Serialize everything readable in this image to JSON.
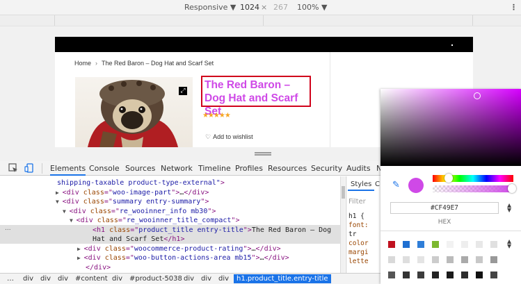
{
  "device_toolbar": {
    "mode": "Responsive ▼",
    "width": "1024",
    "times": "×",
    "height": "267",
    "zoom": "100% ▼",
    "menu_icon": "more-vertical-icon"
  },
  "page": {
    "breadcrumb": {
      "home": "Home",
      "separator": "›",
      "current": "The Red Baron – Dog Hat and Scarf Set"
    },
    "product_title": "The Red Baron – Dog Hat and Scarf Set",
    "title_color": "#cf49e7",
    "stars": "★★★★★",
    "wishlist": "Add to wishlist"
  },
  "devtools": {
    "tabs": [
      "Elements",
      "Console",
      "Sources",
      "Network",
      "Timeline",
      "Profiles",
      "Resources",
      "Security",
      "Audits",
      "N"
    ],
    "active_tab": "Elements",
    "elements": [
      {
        "indent": 82,
        "tri": "",
        "parts": [
          [
            "av",
            "shipping-taxable product-type-external\""
          ],
          [
            "tg",
            ">"
          ]
        ]
      },
      {
        "indent": 92,
        "tri": "▶",
        "parts": [
          [
            "tg",
            "<div "
          ],
          [
            "an",
            "class"
          ],
          [
            "tg",
            "=\""
          ],
          [
            "av",
            "woo-image-part"
          ],
          [
            "tg",
            "\">"
          ],
          [
            "tx",
            "…"
          ],
          [
            "tg",
            "</div>"
          ]
        ]
      },
      {
        "indent": 92,
        "tri": "▼",
        "parts": [
          [
            "tg",
            "<div "
          ],
          [
            "an",
            "class"
          ],
          [
            "tg",
            "=\""
          ],
          [
            "av",
            "summary entry-summary"
          ],
          [
            "tg",
            "\">"
          ]
        ]
      },
      {
        "indent": 102,
        "tri": "▼",
        "parts": [
          [
            "tg",
            "<div "
          ],
          [
            "an",
            "class"
          ],
          [
            "tg",
            "=\""
          ],
          [
            "av",
            "re_wooinner_info mb30"
          ],
          [
            "tg",
            "\">"
          ]
        ]
      },
      {
        "indent": 112,
        "tri": "▼",
        "parts": [
          [
            "tg",
            "<div "
          ],
          [
            "an",
            "class"
          ],
          [
            "tg",
            "=\""
          ],
          [
            "av",
            "re_wooinner_title_compact"
          ],
          [
            "tg",
            "\">"
          ]
        ]
      },
      {
        "indent": 133,
        "tri": "",
        "parts": [
          [
            "tg",
            "<h1 "
          ],
          [
            "an",
            "class"
          ],
          [
            "tg",
            "=\""
          ],
          [
            "av",
            "product_title entry-title"
          ],
          [
            "tg",
            "\">"
          ],
          [
            "tx",
            "The Red Baron – Dog"
          ]
        ]
      },
      {
        "indent": 133,
        "tri": "",
        "parts": [
          [
            "tx",
            "Hat and Scarf Set"
          ],
          [
            "tg",
            "</h1>"
          ]
        ]
      },
      {
        "indent": 123,
        "tri": "▶",
        "parts": [
          [
            "tg",
            "<div "
          ],
          [
            "an",
            "class"
          ],
          [
            "tg",
            "=\""
          ],
          [
            "av",
            "woocommerce-product-rating"
          ],
          [
            "tg",
            "\">"
          ],
          [
            "tx",
            "…"
          ],
          [
            "tg",
            "</div>"
          ]
        ]
      },
      {
        "indent": 123,
        "tri": "▶",
        "parts": [
          [
            "tg",
            "<div "
          ],
          [
            "an",
            "class"
          ],
          [
            "tg",
            "=\""
          ],
          [
            "av",
            "woo-button-actions-area mb15"
          ],
          [
            "tg",
            "\">"
          ],
          [
            "tx",
            "…"
          ],
          [
            "tg",
            "</div>"
          ]
        ]
      },
      {
        "indent": 123,
        "tri": "",
        "parts": [
          [
            "tg",
            "</div>"
          ]
        ]
      }
    ],
    "selected_marker": "...",
    "styles": {
      "tab": "Styles",
      "tab2": "C",
      "filter_placeholder": "Filter",
      "rules": [
        [
          [
            "tx",
            "h1 {"
          ]
        ],
        [
          [
            "an",
            "  font:"
          ]
        ],
        [
          [
            "tx",
            "    tr"
          ]
        ],
        [
          [
            "an",
            "color"
          ]
        ],
        [
          [
            "an",
            "margi"
          ]
        ],
        [
          [
            "an",
            "lette"
          ]
        ]
      ]
    },
    "breadcrumbs": [
      "…",
      "div",
      "div",
      "div",
      "#content",
      "div",
      "#product-5038",
      "div",
      "div",
      "div",
      "h1.product_title.entry-title"
    ]
  },
  "color_picker": {
    "hex": "#CF49E7",
    "format_label": "HEX",
    "color": "#cf49e7",
    "palette": [
      "#c0111f",
      "#1f6fd1",
      "#2f7ed8",
      "#7cb82f",
      "#f2f2f2",
      "#eeeeee",
      "#e8e8e8",
      "#e0e0e0",
      "#d9d9d9",
      "#dedede",
      "#e4e4e4",
      "#cccccc",
      "#bbbbbb",
      "#aaaaaa",
      "#c8c8c8",
      "#999999",
      "#555555",
      "#333333",
      "#3c3c3c",
      "#222222",
      "#1a1a1a",
      "#2c2c2c",
      "#111111",
      "#444444"
    ]
  }
}
